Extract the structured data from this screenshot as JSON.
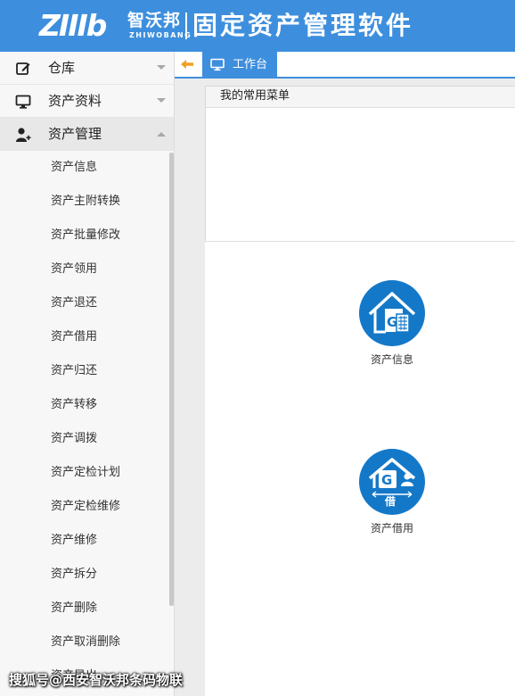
{
  "header": {
    "logo_mark": "ZIIIb",
    "logo_cn": "智沃邦",
    "logo_en": "ZHIWOBANG",
    "app_title": "固定资产管理软件",
    "bg_color": "#3d8fdd"
  },
  "sidebar": {
    "groups": [
      {
        "label": "仓库",
        "icon": "edit-icon",
        "expanded": false
      },
      {
        "label": "资产资料",
        "icon": "monitor-icon",
        "expanded": false
      },
      {
        "label": "资产管理",
        "icon": "user-add-icon",
        "expanded": true
      }
    ],
    "sub_items": [
      "资产信息",
      "资产主附转换",
      "资产批量修改",
      "资产领用",
      "资产退还",
      "资产借用",
      "资产归还",
      "资产转移",
      "资产调拨",
      "资产定检计划",
      "资产定检维修",
      "资产维修",
      "资产拆分",
      "资产删除",
      "资产取消删除",
      "资产导出"
    ]
  },
  "tabs": {
    "back_icon": "arrow-left-icon",
    "active": {
      "label": "工作台",
      "icon": "monitor-icon"
    }
  },
  "content": {
    "menu_panel_title": "我的常用菜单",
    "shortcuts": [
      {
        "label": "资产信息",
        "icon": "asset-info-icon"
      },
      {
        "label": "资产借用",
        "icon": "asset-borrow-icon",
        "badge": "借"
      }
    ],
    "accent_color": "#1478c8"
  },
  "watermark": "搜狐号@西安智沃邦条码物联"
}
